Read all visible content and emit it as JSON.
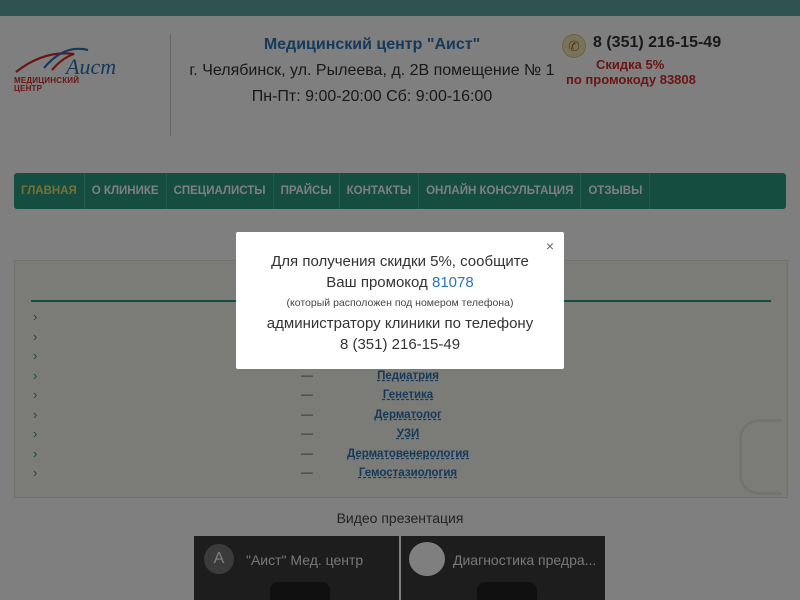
{
  "header": {
    "logo": {
      "script": "Аист",
      "line1": "МЕДИЦИНСКИЙ",
      "line2": "ЦЕНТР"
    },
    "title": "Медицинский центр \"Аист\"",
    "address": "г. Челябинск, ул. Рылеева, д. 2В помещение № 1",
    "hours": "Пн-Пт: 9:00-20:00 Сб: 9:00-16:00",
    "phone": "8 (351) 216-15-49",
    "promo_line1": "Скидка 5%",
    "promo_line2": "по промокоду 83808"
  },
  "nav": {
    "items": [
      {
        "label": "ГЛАВНАЯ",
        "active": true
      },
      {
        "label": "О КЛИНИКЕ"
      },
      {
        "label": "СПЕЦИАЛИСТЫ"
      },
      {
        "label": "ПРАЙСЫ"
      },
      {
        "label": "КОНТАКТЫ"
      },
      {
        "label": "ОНЛАЙН КОНСУЛЬТАЦИЯ"
      },
      {
        "label": "ОТЗЫВЫ"
      }
    ]
  },
  "services": {
    "items": [
      {
        "label": ""
      },
      {
        "label": ""
      },
      {
        "label": ""
      },
      {
        "label": "Педиатрия"
      },
      {
        "label": "Генетика"
      },
      {
        "label": "Дерматолог"
      },
      {
        "label": "УЗИ"
      },
      {
        "label": "Дерматовенерология"
      },
      {
        "label": "Гемостазиология"
      }
    ]
  },
  "video": {
    "section_label": "Видео презентация",
    "items": [
      {
        "avatar_letter": "А",
        "title": "\"Аист\" Мед. центр"
      },
      {
        "title": "Диагностика предра..."
      }
    ]
  },
  "modal": {
    "close_glyph": "×",
    "line1": "Для получения скидки 5%, сообщите",
    "line2_prefix": "Ваш промокод",
    "code": "81078",
    "note": "(который расположен под номером телефона)",
    "line3": "администратору клиники по телефону",
    "phone": "8 (351) 216-15-49"
  },
  "colors": {
    "accent": "#2a9a82",
    "link": "#2a74b8",
    "promo": "#d62a2a"
  },
  "icons": {
    "phone": "phone-icon",
    "close": "close-icon",
    "chevron": "chevron-right-icon"
  }
}
